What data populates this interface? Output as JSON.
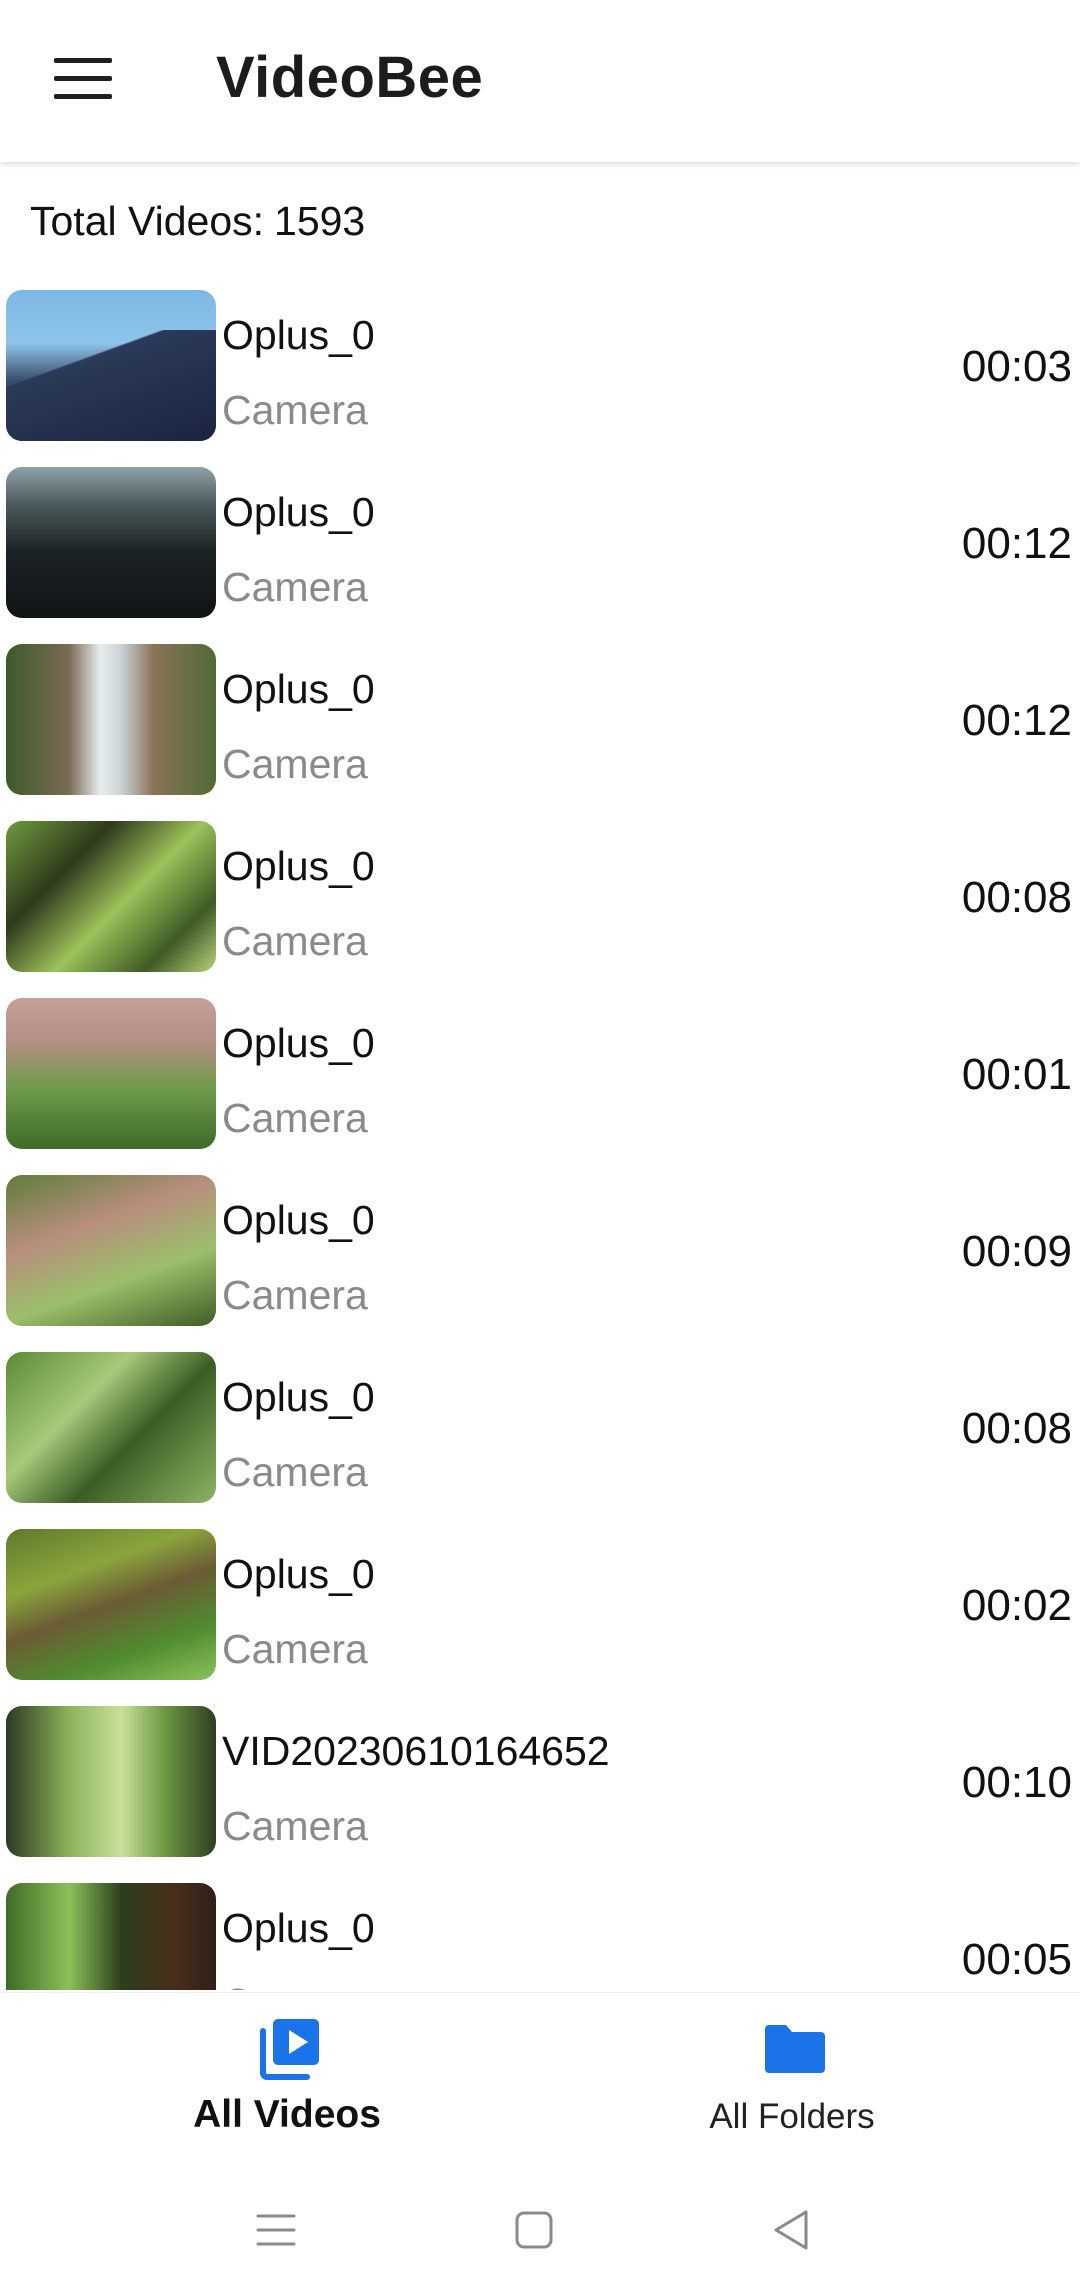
{
  "app_bar": {
    "title": "VideoBee",
    "menu_icon": "hamburger-menu-icon"
  },
  "summary": {
    "label": "Total Videos:",
    "count": "1593"
  },
  "videos": [
    {
      "title": "Oplus_0",
      "folder": "Camera",
      "duration": "00:03",
      "thumb": "t-mountain"
    },
    {
      "title": "Oplus_0",
      "folder": "Camera",
      "duration": "00:12",
      "thumb": "t-dark"
    },
    {
      "title": "Oplus_0",
      "folder": "Camera",
      "duration": "00:12",
      "thumb": "t-waterfall"
    },
    {
      "title": "Oplus_0",
      "folder": "Camera",
      "duration": "00:08",
      "thumb": "t-green1"
    },
    {
      "title": "Oplus_0",
      "folder": "Camera",
      "duration": "00:01",
      "thumb": "t-rock1"
    },
    {
      "title": "Oplus_0",
      "folder": "Camera",
      "duration": "00:09",
      "thumb": "t-rock2"
    },
    {
      "title": "Oplus_0",
      "folder": "Camera",
      "duration": "00:08",
      "thumb": "t-green2"
    },
    {
      "title": "Oplus_0",
      "folder": "Camera",
      "duration": "00:02",
      "thumb": "t-grass"
    },
    {
      "title": "VID20230610164652",
      "folder": "Camera",
      "duration": "00:10",
      "thumb": "t-forest"
    },
    {
      "title": "Oplus_0",
      "folder": "Camera",
      "duration": "00:05",
      "thumb": "t-trees"
    }
  ],
  "bottom_nav": {
    "items": [
      {
        "label": "All Videos",
        "icon": "video-library-icon",
        "active": true
      },
      {
        "label": "All Folders",
        "icon": "folder-icon",
        "active": false
      }
    ],
    "accent_color": "#1a73e8"
  },
  "system_nav": {
    "buttons": [
      "recent-apps-icon",
      "home-icon",
      "back-icon"
    ]
  }
}
